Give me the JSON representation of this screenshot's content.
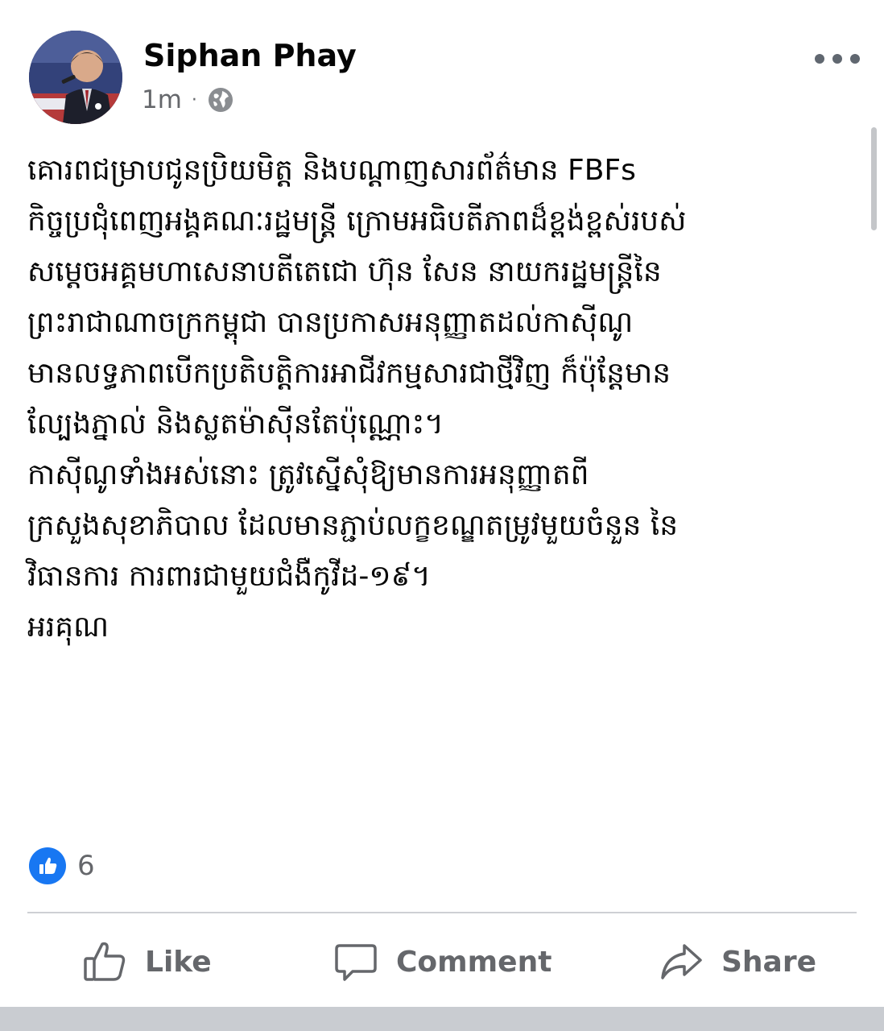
{
  "post": {
    "author": "Siphan Phay",
    "timestamp": "1m",
    "separator": "·",
    "privacy_icon": "globe-icon",
    "menu_icon": "more-options-icon",
    "text_lines": [
      "គោរពជម្រាបជូនប្រិយមិត្ត និងបណ្តាញសារព័ត៌មាន FBFs",
      " កិច្ចប្រជុំពេញអង្គគណៈរដ្ឋមន្ត្រី ក្រោមអធិបតីភាពដ៏ខ្ពង់ខ្ពស់របស់",
      "សម្តេចអគ្គមហាសេនាបតីតេជោ ហ៊ុន សែន នាយករដ្ឋមន្ត្រីនៃ",
      "ព្រះរាជាណាចក្រកម្ពុជា បានប្រកាសអនុញ្ញាតដល់កាស៊ីណូ",
      "មានលទ្ធភាពបើកប្រតិបត្តិការអាជីវកម្មសារជាថ្មីវិញ ក៏ប៉ុន្តែមាន",
      "ល្បែងភ្នាល់ និងស្លតម៉ាស៊ីនតែប៉ុណ្ណោះ។",
      "កាស៊ីណូទាំងអស់នោះ ត្រូវស្នើសុំឱ្យមានការអនុញ្ញាតពី",
      "ក្រសួងសុខាភិបាល ដែលមានភ្ជាប់លក្ខខណ្ឌតម្រូវមួយចំនួន នៃ",
      "វិធានការ ការពារជាមួយជំងឺកូវីដ-១៩។",
      "អរគុណ"
    ],
    "reactions": {
      "icon": "like-reaction-icon",
      "count": "6"
    }
  },
  "actions": {
    "like": "Like",
    "comment": "Comment",
    "share": "Share"
  },
  "colors": {
    "text": "#050505",
    "secondary_text": "#65676b",
    "like_blue": "#1877f2",
    "divider": "#ced0d4"
  }
}
